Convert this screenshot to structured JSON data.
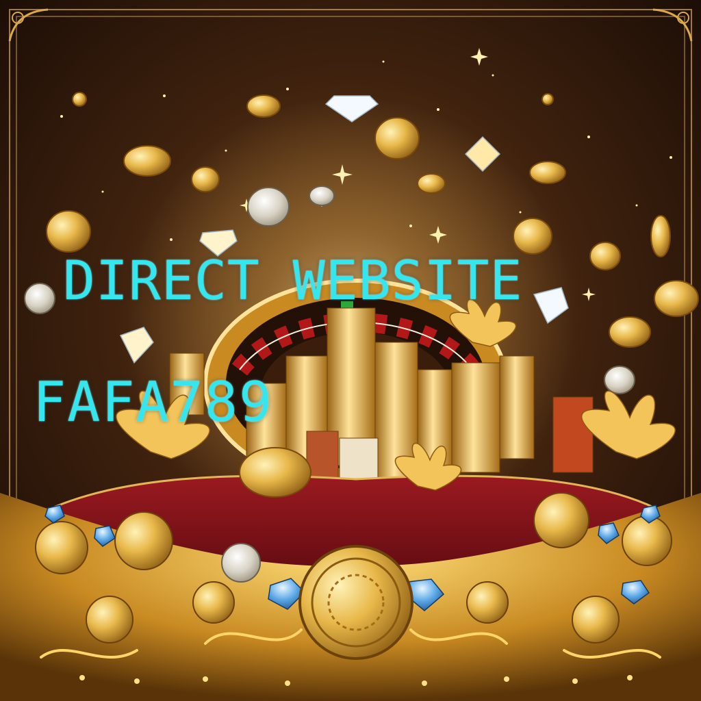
{
  "overlay": {
    "line1": "DIRECT WEBSITE",
    "line2": "FAFA789"
  },
  "palette": {
    "background_dark": "#1a0d06",
    "gold": "#e8b84a",
    "gold_light": "#ffe39a",
    "felt_red": "#7a1016",
    "diamond_blue": "#5aa7e6",
    "text_cyan": "#34e6ee"
  },
  "icons": [
    "gold-coin-icon",
    "diamond-icon",
    "roulette-wheel-icon",
    "chip-stack-icon",
    "gold-flower-icon",
    "ornate-frame-icon"
  ]
}
